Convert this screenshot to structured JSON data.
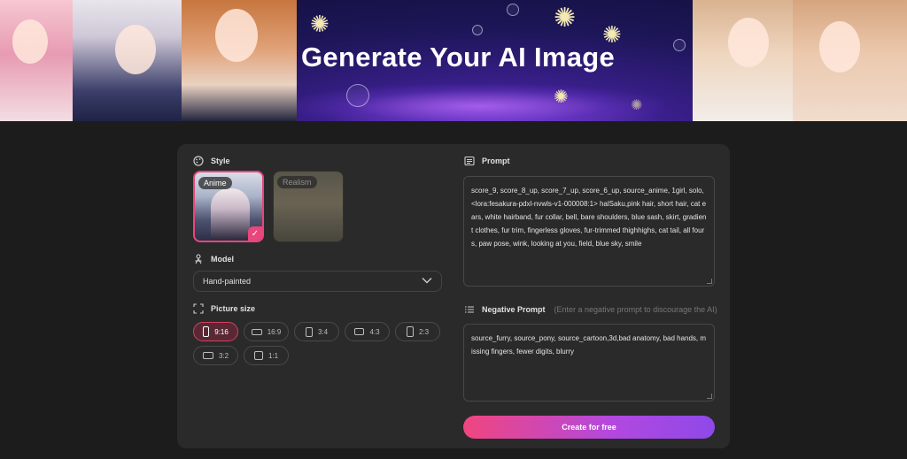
{
  "banner": {
    "title": "Generate Your AI Image"
  },
  "style_section": {
    "label": "Style",
    "options": [
      {
        "label": "Anime",
        "selected": true
      },
      {
        "label": "Realism",
        "selected": false
      }
    ]
  },
  "model_section": {
    "label": "Model",
    "selected": "Hand-painted"
  },
  "picture_size": {
    "label": "Picture size",
    "options": [
      "9:16",
      "16:9",
      "3:4",
      "4:3",
      "2:3",
      "3:2",
      "1:1"
    ],
    "selected": "9:16"
  },
  "prompt": {
    "label": "Prompt",
    "value": "score_9, score_8_up, score_7_up, score_6_up, source_anime, 1girl, solo, <lora:fesakura-pdxl-nvwls-v1-000008:1> halSaku,pink hair, short hair, cat ears, white hairband, fur collar, bell, bare shoulders, blue sash, skirt, gradient clothes, fur trim, fingerless gloves, fur-trimmed thighhighs, cat tail, all fours, paw pose, wink, looking at you, field, blue sky, smile"
  },
  "negative_prompt": {
    "label": "Negative Prompt",
    "hint": "(Enter a negative prompt to discourage the AI)",
    "value": "source_furry, source_pony, source_cartoon,3d,bad anatomy, bad hands, missing fingers, fewer digits, blurry"
  },
  "create_button": {
    "label": "Create for free"
  },
  "colors": {
    "accent_pink": "#e8467c",
    "accent_purple": "#8e49e8",
    "panel": "#2a2a2a",
    "background": "#1c1c1c"
  }
}
